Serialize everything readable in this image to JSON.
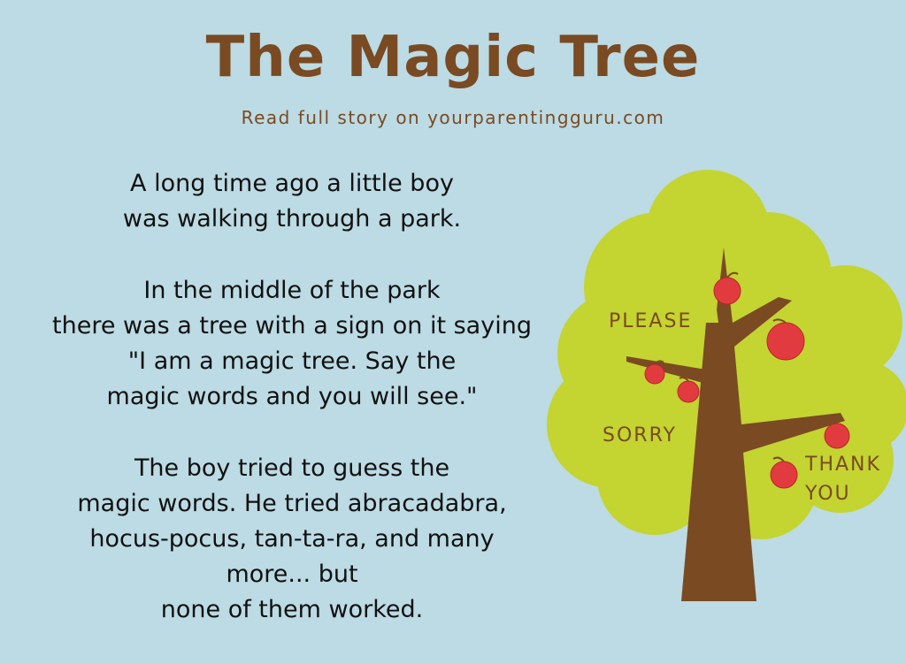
{
  "header": {
    "title": "The Magic Tree",
    "subtitle": "Read full story on yourparentingguru.com"
  },
  "story": {
    "paragraphs": [
      [
        "A long time ago a little boy",
        "was walking through a park."
      ],
      [
        "In the middle of the park",
        "there was a tree with a sign on it saying",
        "\"I am a magic tree. Say the",
        "magic words and you will see.\""
      ],
      [
        "The boy tried to guess the",
        "magic words. He tried abracadabra,",
        "hocus-pocus, tan-ta-ra, and many",
        "more... but",
        "none of them worked."
      ]
    ]
  },
  "tree": {
    "labels": {
      "please": "PLEASE",
      "sorry": "SORRY",
      "thank": "THANK",
      "you": "YOU"
    }
  },
  "colors": {
    "background": "#bcdbe4",
    "title": "#7a4a22",
    "canopy": "#c4d430",
    "trunk": "#7a4a22",
    "apple": "#e23b3f"
  }
}
